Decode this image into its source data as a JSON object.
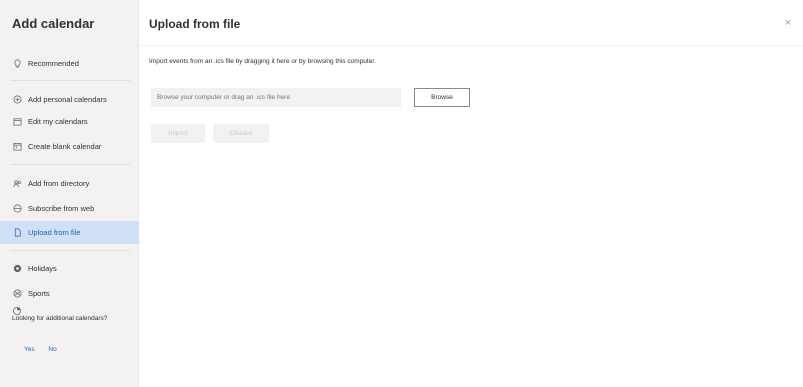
{
  "sidebar": {
    "title": "Add calendar",
    "items": [
      {
        "label": "Recommended",
        "icon": "lightbulb-icon"
      },
      {
        "label": "Add personal calendars",
        "icon": "add-circle-icon"
      },
      {
        "label": "Edit my calendars",
        "icon": "edit-calendar-icon"
      },
      {
        "label": "Create blank calendar",
        "icon": "calendar-icon"
      },
      {
        "label": "Add from directory",
        "icon": "people-icon"
      },
      {
        "label": "Subscribe from web",
        "icon": "globe-icon"
      },
      {
        "label": "Upload from file",
        "icon": "file-icon"
      },
      {
        "label": "Holidays",
        "icon": "holiday-globe-icon"
      },
      {
        "label": "Sports",
        "icon": "sports-icon"
      }
    ],
    "selected_index": 6,
    "feedback": {
      "question": "Looking for additional calendars?",
      "yes": "Yes",
      "no": "No"
    }
  },
  "main": {
    "title": "Upload from file",
    "close_label": "×",
    "instructions": "Import events from an .ics file by dragging it here or by browsing this computer.",
    "file_input_placeholder": "Browse your computer or drag an .ics file here",
    "browse_label": "Browse",
    "import_label": "Import",
    "discard_label": "Discard"
  },
  "colors": {
    "sidebar_bg": "#f3f2f1",
    "selected_bg": "#cfe0f7",
    "accent": "#2b62b9"
  }
}
